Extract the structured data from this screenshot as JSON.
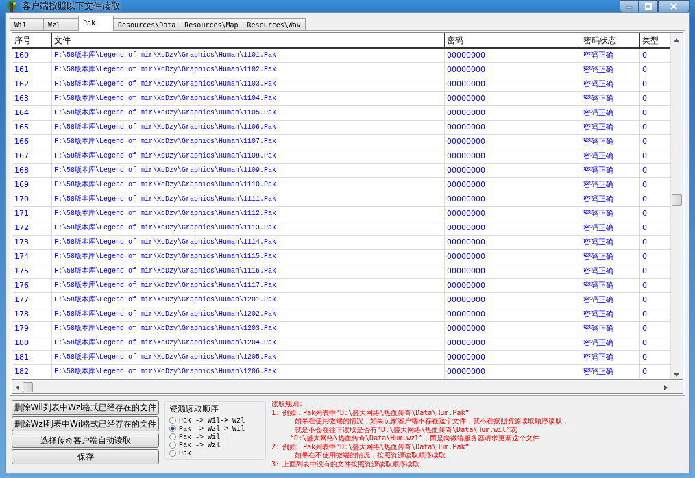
{
  "window": {
    "title": "客户端按照以下文件读取"
  },
  "tabs": [
    {
      "label": "Wil",
      "selected": false
    },
    {
      "label": "Wzl",
      "selected": false
    },
    {
      "label": "Pak",
      "selected": true
    },
    {
      "label": "Resources\\Data",
      "selected": false
    },
    {
      "label": "Resources\\Map",
      "selected": false
    },
    {
      "label": "Resources\\Wav",
      "selected": false
    }
  ],
  "table": {
    "columns": [
      "序号",
      "文件",
      "密码",
      "密码状态",
      "类型"
    ],
    "rows": [
      [
        "160",
        "F:\\58版本库\\Legend of mir\\XcDzy\\Graphics\\Human\\1101.Pak",
        "00000000",
        "密码正确",
        "0"
      ],
      [
        "161",
        "F:\\58版本库\\Legend of mir\\XcDzy\\Graphics\\Human\\1102.Pak",
        "00000000",
        "密码正确",
        "0"
      ],
      [
        "162",
        "F:\\58版本库\\Legend of mir\\XcDzy\\Graphics\\Human\\1103.Pak",
        "00000000",
        "密码正确",
        "0"
      ],
      [
        "163",
        "F:\\58版本库\\Legend of mir\\XcDzy\\Graphics\\Human\\1104.Pak",
        "00000000",
        "密码正确",
        "0"
      ],
      [
        "164",
        "F:\\58版本库\\Legend of mir\\XcDzy\\Graphics\\Human\\1105.Pak",
        "00000000",
        "密码正确",
        "0"
      ],
      [
        "165",
        "F:\\58版本库\\Legend of mir\\XcDzy\\Graphics\\Human\\1106.Pak",
        "00000000",
        "密码正确",
        "0"
      ],
      [
        "166",
        "F:\\58版本库\\Legend of mir\\XcDzy\\Graphics\\Human\\1107.Pak",
        "00000000",
        "密码正确",
        "0"
      ],
      [
        "167",
        "F:\\58版本库\\Legend of mir\\XcDzy\\Graphics\\Human\\1108.Pak",
        "00000000",
        "密码正确",
        "0"
      ],
      [
        "168",
        "F:\\58版本库\\Legend of mir\\XcDzy\\Graphics\\Human\\1109.Pak",
        "00000000",
        "密码正确",
        "0"
      ],
      [
        "169",
        "F:\\58版本库\\Legend of mir\\XcDzy\\Graphics\\Human\\1110.Pak",
        "00000000",
        "密码正确",
        "0"
      ],
      [
        "170",
        "F:\\58版本库\\Legend of mir\\XcDzy\\Graphics\\Human\\1111.Pak",
        "00000000",
        "密码正确",
        "0"
      ],
      [
        "171",
        "F:\\58版本库\\Legend of mir\\XcDzy\\Graphics\\Human\\1112.Pak",
        "00000000",
        "密码正确",
        "0"
      ],
      [
        "172",
        "F:\\58版本库\\Legend of mir\\XcDzy\\Graphics\\Human\\1113.Pak",
        "00000000",
        "密码正确",
        "0"
      ],
      [
        "173",
        "F:\\58版本库\\Legend of mir\\XcDzy\\Graphics\\Human\\1114.Pak",
        "00000000",
        "密码正确",
        "0"
      ],
      [
        "174",
        "F:\\58版本库\\Legend of mir\\XcDzy\\Graphics\\Human\\1115.Pak",
        "00000000",
        "密码正确",
        "0"
      ],
      [
        "175",
        "F:\\58版本库\\Legend of mir\\XcDzy\\Graphics\\Human\\1116.Pak",
        "00000000",
        "密码正确",
        "0"
      ],
      [
        "176",
        "F:\\58版本库\\Legend of mir\\XcDzy\\Graphics\\Human\\1117.Pak",
        "00000000",
        "密码正确",
        "0"
      ],
      [
        "177",
        "F:\\58版本库\\Legend of mir\\XcDzy\\Graphics\\Human\\1201.Pak",
        "00000000",
        "密码正确",
        "0"
      ],
      [
        "178",
        "F:\\58版本库\\Legend of mir\\XcDzy\\Graphics\\Human\\1202.Pak",
        "00000000",
        "密码正确",
        "0"
      ],
      [
        "179",
        "F:\\58版本库\\Legend of mir\\XcDzy\\Graphics\\Human\\1203.Pak",
        "00000000",
        "密码正确",
        "0"
      ],
      [
        "180",
        "F:\\58版本库\\Legend of mir\\XcDzy\\Graphics\\Human\\1204.Pak",
        "00000000",
        "密码正确",
        "0"
      ],
      [
        "181",
        "F:\\58版本库\\Legend of mir\\XcDzy\\Graphics\\Human\\1205.Pak",
        "00000000",
        "密码正确",
        "0"
      ],
      [
        "182",
        "F:\\58版本库\\Legend of mir\\XcDzy\\Graphics\\Human\\1206.Pak",
        "00000000",
        "密码正确",
        "0"
      ]
    ]
  },
  "buttons": [
    "删除Wil列表中Wzl格式已经存在的文件",
    "删除Wzl列表中Wil格式已经存在的文件",
    "选择传奇客户端自动读取",
    "保存"
  ],
  "order_group": {
    "title": "资源读取顺序",
    "options": [
      {
        "label": "Pak -> Wil-> Wzl",
        "selected": false
      },
      {
        "label": "Pak -> Wzl-> Wil",
        "selected": true
      },
      {
        "label": "Pak -> Wil",
        "selected": false
      },
      {
        "label": "Pak -> Wzl",
        "selected": false
      },
      {
        "label": "Pak",
        "selected": false
      }
    ]
  },
  "rules": {
    "title": "读取规则:",
    "items": [
      {
        "number": "1:",
        "lines": [
          "例如：Pak列表中“D:\\盛大网络\\热血传奇\\Data\\Hum.Pak”",
          "如果在使用微端的情况，如果玩家客户端不存在这个文件，就不在按照资源读取顺序读取，",
          "就是不会在往下读取是否有“D:\\盛大网络\\热血传奇\\Data\\Hum.wil”或",
          "“D:\\盛大网络\\热血传奇\\Data\\Hum.wzl”，而是向微端服务器请求更新这个文件"
        ]
      },
      {
        "number": "2:",
        "lines": [
          "例如：Pak列表中“D:\\盛大网络\\热血传奇\\Data\\Hum.Pak”",
          "如果在不使用微端的情况，按照资源读取顺序读取"
        ]
      },
      {
        "number": "3:",
        "lines": [
          "上面列表中没有的文件按照资源读取顺序读取"
        ]
      }
    ]
  }
}
